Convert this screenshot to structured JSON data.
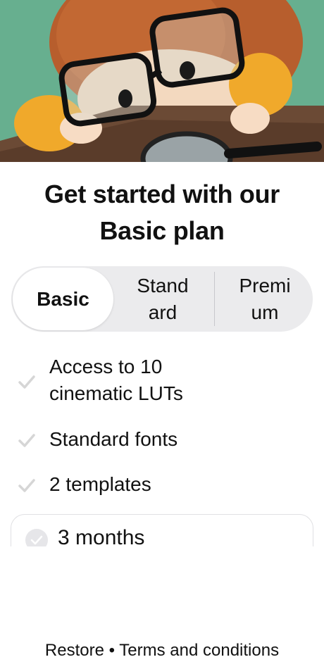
{
  "hero": {
    "image": "illustration-child-with-glasses-and-magnifying-glass"
  },
  "title": {
    "line1": "Get started with our",
    "line2": "Basic plan"
  },
  "plan_tabs": [
    {
      "label": "Basic",
      "selected": true
    },
    {
      "label": "Standard",
      "display_lines": [
        "Stand",
        "ard"
      ],
      "selected": false
    },
    {
      "label": "Premium",
      "display_lines": [
        "Premi",
        "um"
      ],
      "selected": false
    }
  ],
  "features": [
    {
      "lines": [
        "Access to 10",
        "cinematic LUTs"
      ],
      "icon": "check-icon"
    },
    {
      "lines": [
        "Standard fonts"
      ],
      "icon": "check-icon"
    },
    {
      "lines": [
        "2 templates"
      ],
      "icon": "check-icon"
    }
  ],
  "duration_option": {
    "label": "3 months",
    "icon": "radio-check-icon"
  },
  "footer": {
    "restore": "Restore",
    "separator": "•",
    "terms": "Terms and conditions"
  },
  "colors": {
    "background": "#ffffff",
    "segment_bg": "#ebebed",
    "check": "#d6d6d6",
    "text": "#111111"
  }
}
